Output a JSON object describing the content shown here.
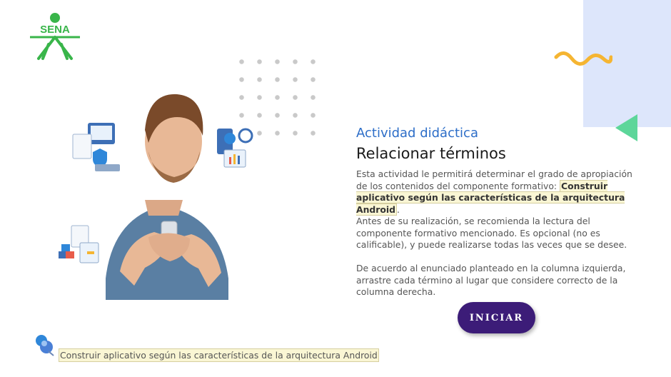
{
  "brand": {
    "logo_text": "SENA",
    "color": "#39b54a"
  },
  "activity": {
    "subtitle": "Actividad didáctica",
    "title": "Relacionar términos",
    "p1_prefix": "Esta actividad le permitirá determinar el grado de apropiación de los contenidos del componente formativo: ",
    "p1_highlight": "Construir aplicativo según las características de la arquitectura Android",
    "p1_suffix": ".",
    "p2": "Antes de su realización, se recomienda la lectura del componente formativo mencionado.  Es opcional (no es calificable), y puede realizarse todas las veces que se desee.",
    "p3": "De acuerdo al enunciado planteado en la columna izquierda, arrastre cada término al lugar que considere correcto de la columna derecha."
  },
  "start_button": {
    "label": "INICIAR",
    "color": "#3c1c78"
  },
  "footer": {
    "label": "Construir aplicativo según las características de la arquitectura Android"
  },
  "colors": {
    "accent_blue": "#2d6ec8",
    "panel": "#dde6fb",
    "triangle": "#5dd69a",
    "wave": "#f5b532"
  },
  "icons": [
    "sena-logo-icon",
    "pushpin-icon",
    "wave-decoration-icon",
    "triangle-decoration-icon"
  ]
}
